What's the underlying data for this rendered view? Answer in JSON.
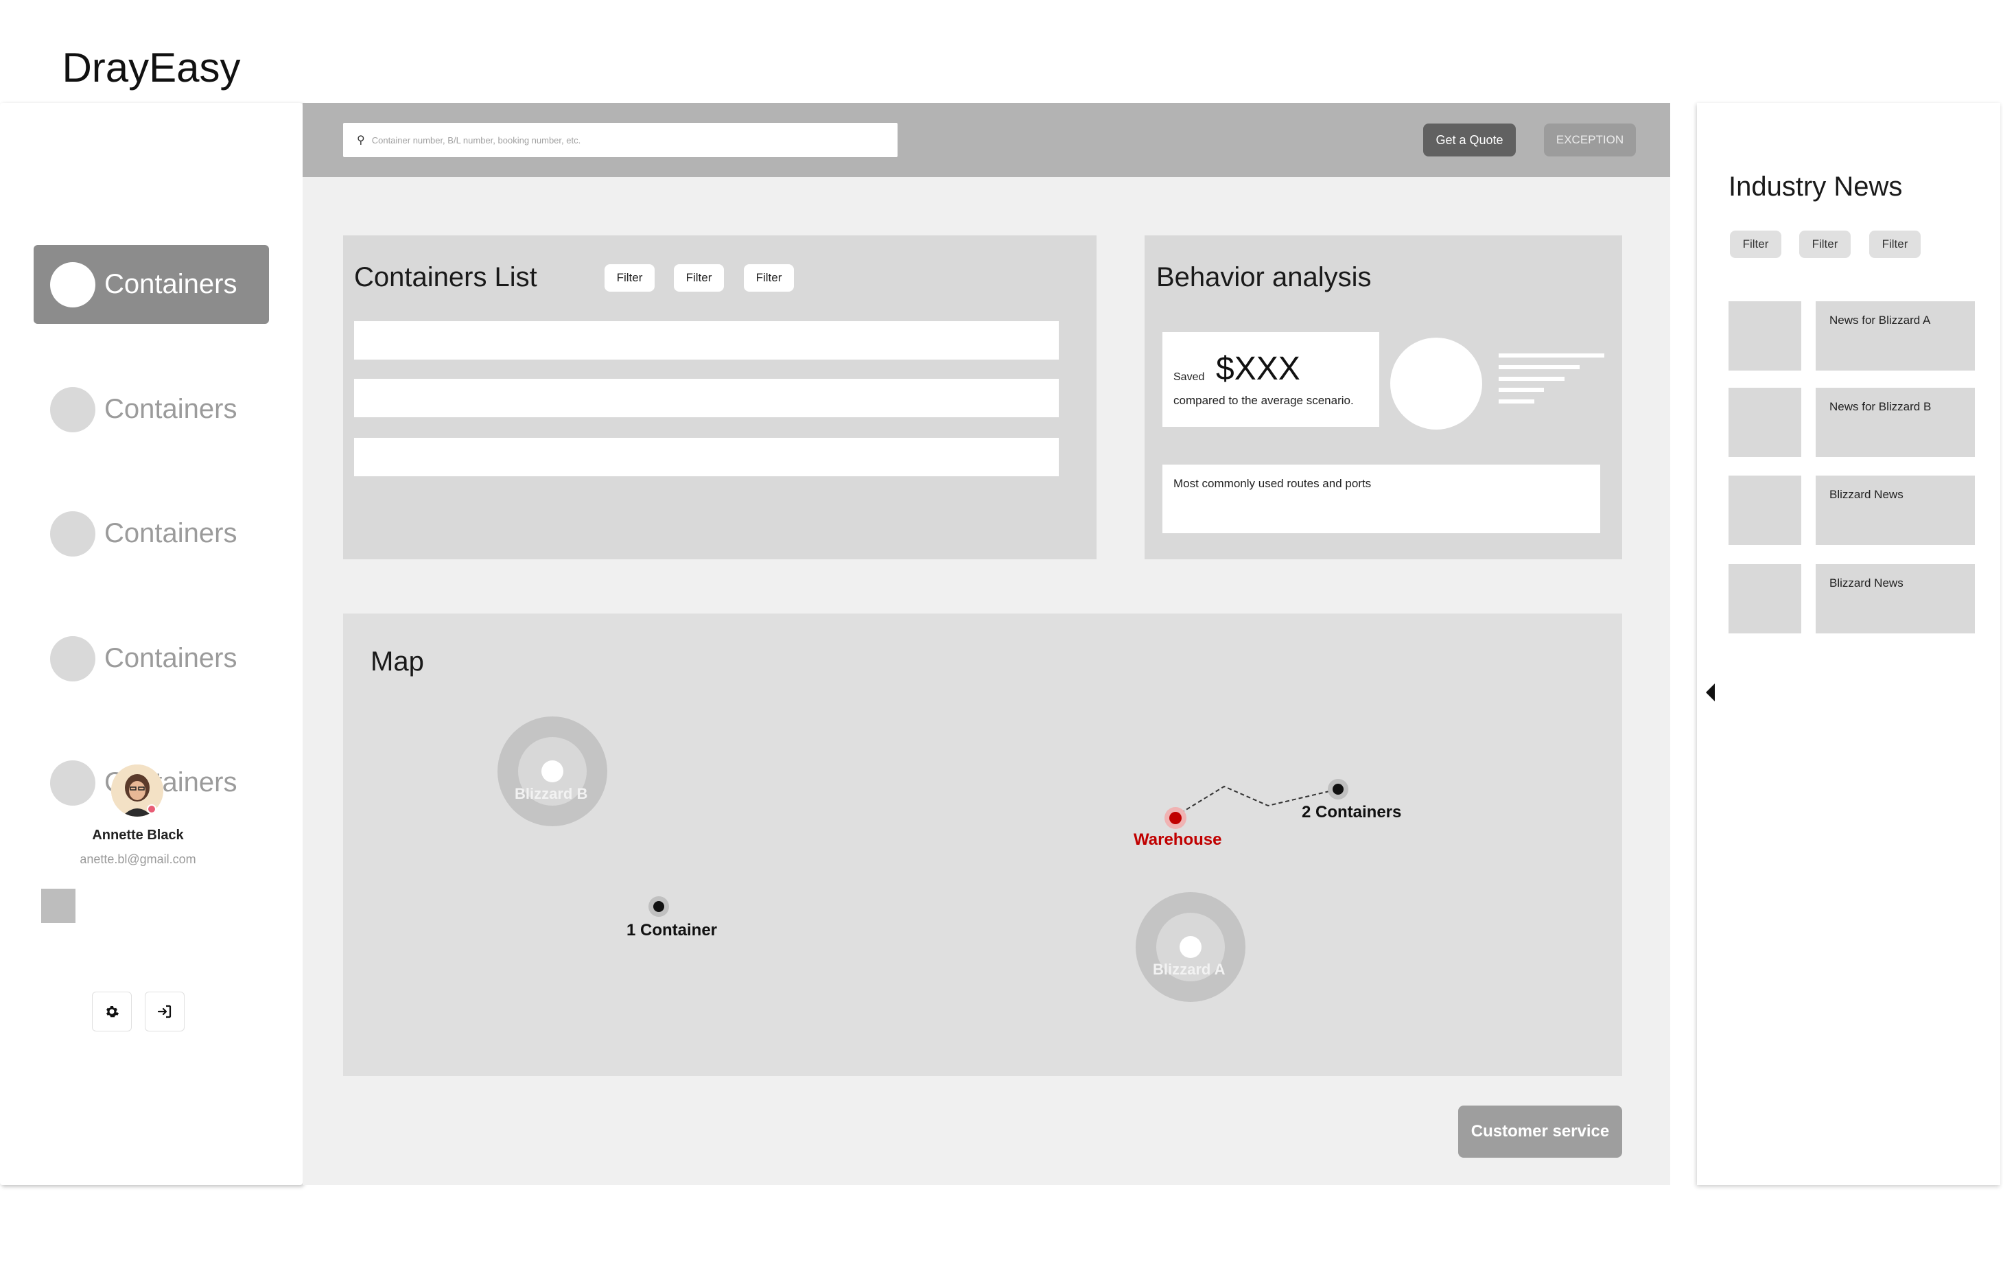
{
  "app": {
    "logo": "DrayEasy"
  },
  "sidebar": {
    "items": [
      {
        "label": "Containers",
        "active": true
      },
      {
        "label": "Containers",
        "active": false
      },
      {
        "label": "Containers",
        "active": false
      },
      {
        "label": "Containers",
        "active": false
      },
      {
        "label": "Containers",
        "active": false
      }
    ],
    "user": {
      "name": "Annette Black",
      "email": "anette.bl@gmail.com"
    },
    "actions": [
      "settings-icon",
      "logout-icon"
    ]
  },
  "header": {
    "search": {
      "placeholder": "Container number, B/L number, booking number, etc."
    },
    "quote_button": "Get a Quote",
    "exception_button": "EXCEPTION"
  },
  "containers_list": {
    "title": "Containers List",
    "filters": [
      "Filter",
      "Filter",
      "Filter"
    ]
  },
  "behavior": {
    "title": "Behavior analysis",
    "saved_label": "Saved",
    "saved_amount": "$XXX",
    "saved_desc": "compared to the average scenario.",
    "routes_label": "Most commonly used routes and ports"
  },
  "map": {
    "title": "Map",
    "storms": [
      {
        "label": "Blizzard B"
      },
      {
        "label": "Blizzard A"
      }
    ],
    "markers": [
      {
        "label": "1 Container"
      },
      {
        "label": "2 Containers"
      },
      {
        "label": "Warehouse"
      }
    ]
  },
  "customer_service": "Customer service",
  "news": {
    "title": "Industry News",
    "filters": [
      "Filter",
      "Filter",
      "Filter"
    ],
    "items": [
      {
        "title": "News for Blizzard A"
      },
      {
        "title": "News for Blizzard B"
      },
      {
        "title": "Blizzard News"
      },
      {
        "title": "Blizzard News"
      }
    ]
  },
  "colors": {
    "accent_gray": "#8c8c8c",
    "topbar": "#b3b3b3",
    "warehouse_red": "#c00000"
  }
}
